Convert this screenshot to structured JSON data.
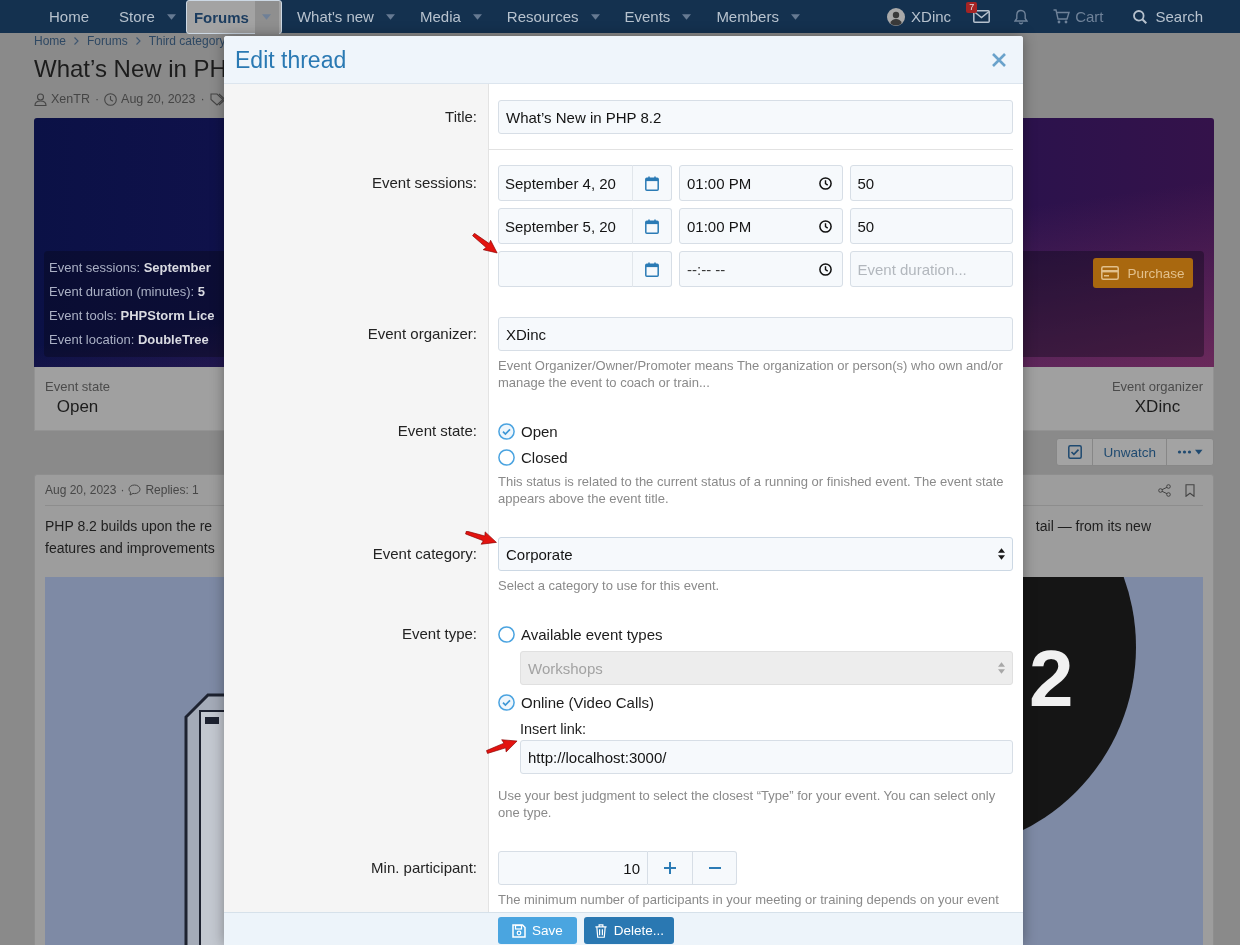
{
  "nav": {
    "items": [
      {
        "label": "Home",
        "dropdown": false,
        "selected": false
      },
      {
        "label": "Store",
        "dropdown": true,
        "selected": false
      },
      {
        "label": "Forums",
        "dropdown": true,
        "selected": true
      },
      {
        "label": "What's new",
        "dropdown": true,
        "selected": false
      },
      {
        "label": "Media",
        "dropdown": true,
        "selected": false
      },
      {
        "label": "Resources",
        "dropdown": true,
        "selected": false
      },
      {
        "label": "Events",
        "dropdown": true,
        "selected": false
      },
      {
        "label": "Members",
        "dropdown": true,
        "selected": false
      }
    ],
    "user": "XDinc",
    "badge": "7",
    "cart": "Cart",
    "search": "Search"
  },
  "page": {
    "breadcrumb": [
      "Home",
      "Forums",
      "Third category"
    ],
    "title": "What’s New in PH",
    "meta": [
      {
        "kind": "author",
        "text": "XenTR"
      },
      {
        "kind": "sep",
        "text": "·"
      },
      {
        "kind": "date",
        "text": "Aug 20, 2023"
      },
      {
        "kind": "sep",
        "text": "·"
      },
      {
        "kind": "tags"
      }
    ],
    "banner": {
      "info": [
        "Event sessions: **September**",
        "Event duration (minutes): **5**",
        "Event tools: **PHPStorm Lice**",
        "Event location: **DoubleTree**"
      ],
      "purchase": "Purchase"
    },
    "stats": [
      {
        "label": "Event state",
        "value": "Open"
      },
      {
        "label": "Event organizer",
        "value": "XDinc"
      }
    ],
    "actions": {
      "watch": "Unwatch"
    },
    "post": {
      "meta": [
        {
          "kind": "date",
          "text": "Aug 20, 2023"
        },
        {
          "kind": "sep",
          "text": "·"
        },
        {
          "kind": "replies",
          "text": "Replies: 1"
        }
      ],
      "lines": [
        "PHP 8.2 builds upon the re",
        "features and improvements"
      ],
      "continuation": "tail — from its new",
      "image_text": "2"
    }
  },
  "edit_dialog": {
    "title": "Edit thread",
    "title_field": {
      "label": "Title:",
      "value": "What’s New in PHP 8.2"
    },
    "sessions": {
      "label": "Event sessions:",
      "rows": [
        {
          "date": "September 4, 20",
          "time": "01:00 PM",
          "duration": "50"
        },
        {
          "date": "September 5, 20",
          "time": "01:00 PM",
          "duration": "50"
        },
        {
          "time_placeholder": "--:-- --",
          "duration_placeholder": "Event duration..."
        }
      ]
    },
    "organizer": {
      "label": "Event organizer:",
      "value": "XDinc",
      "hint": "Event Organizer/Owner/Promoter means The organization or person(s) who own and/or manage the event to coach or train..."
    },
    "state": {
      "label": "Event state:",
      "options": [
        {
          "label": "Open",
          "selected": true
        },
        {
          "label": "Closed",
          "selected": false
        }
      ],
      "hint": "This status is related to the current status of a running or finished event. The event state appears above the event title."
    },
    "category": {
      "label": "Event category:",
      "value": "Corporate",
      "hint": "Select a category to use for this event."
    },
    "event_type": {
      "label": "Event type:",
      "options": [
        {
          "label": "Available event types",
          "selected": false,
          "select": {
            "value": "Workshops",
            "disabled": true
          }
        },
        {
          "label": "Online (Video Calls)",
          "selected": true,
          "link": {
            "label": "Insert link:",
            "value": "http://localhost:3000/"
          }
        }
      ],
      "hint": "Use your best judgment to select the closest “Type” for your event. You can select only one type."
    },
    "min_participant": {
      "label": "Min. participant:",
      "value": "10",
      "hint": "The minimum number of participants in your meeting or training depends on your event"
    },
    "buttons": [
      {
        "kind": "save",
        "label": "Save"
      },
      {
        "kind": "delete",
        "label": "Delete..."
      }
    ]
  }
}
